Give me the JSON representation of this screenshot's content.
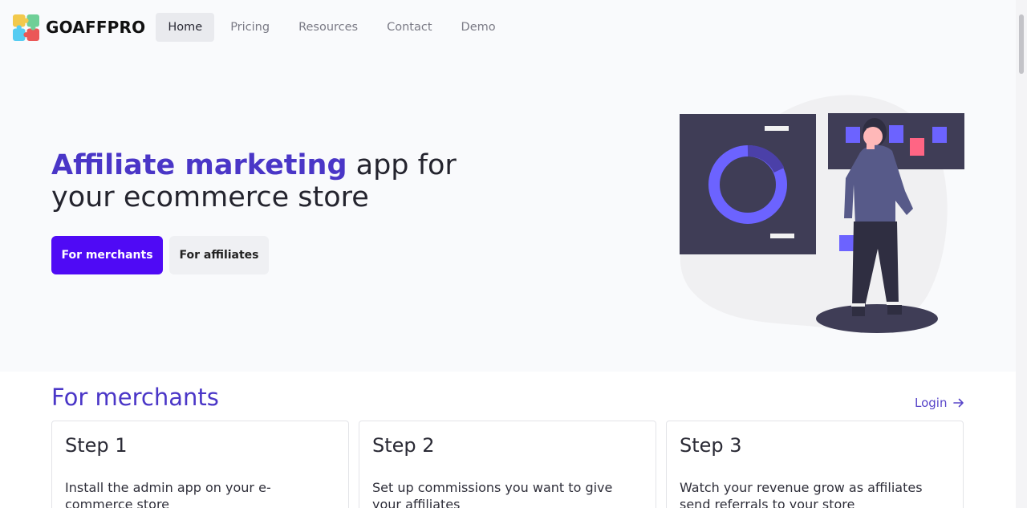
{
  "brand": {
    "name": "GOAFFPRO"
  },
  "nav": {
    "links": [
      "Home",
      "Pricing",
      "Resources",
      "Contact",
      "Demo"
    ],
    "active": "Home"
  },
  "hero": {
    "title_accent": "Affiliate marketing",
    "title_rest": " app for your ecommerce store",
    "primary_button": "For merchants",
    "secondary_button": "For affiliates"
  },
  "merchants": {
    "title": "For merchants",
    "login_label": "Login",
    "steps": [
      {
        "title": "Step 1",
        "text": "Install the admin app on your e-commerce store"
      },
      {
        "title": "Step 2",
        "text": "Set up commissions you want to give your affiliates"
      },
      {
        "title": "Step 3",
        "text": "Watch your revenue grow as affiliates send referrals to your store"
      }
    ]
  },
  "colors": {
    "accent": "#4a36c7",
    "primary_button": "#4f0af5",
    "illustration_dark": "#3f3d56",
    "illustration_purple": "#6c63ff",
    "illustration_pink": "#ff6584"
  }
}
